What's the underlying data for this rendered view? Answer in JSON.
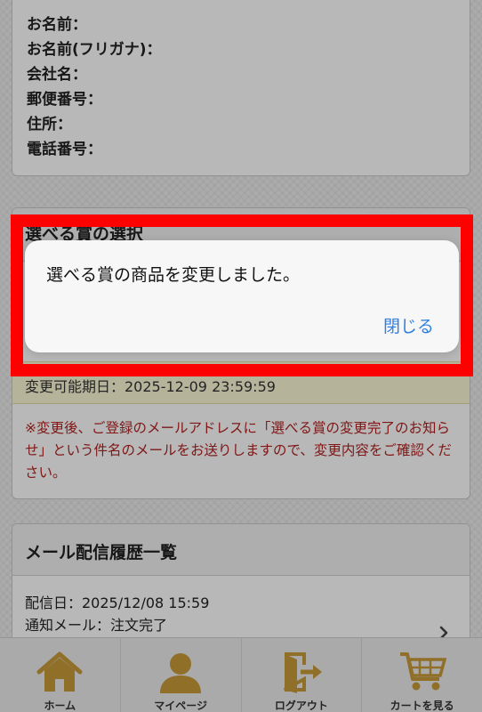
{
  "address": {
    "rows": [
      "お名前：",
      "お名前(フリガナ)：",
      "会社名：",
      "郵便番号：",
      "住所：",
      "電話番号："
    ]
  },
  "prize": {
    "title": "選べる賞の選択",
    "deadline": "変更可能期日：2025-12-09 23:59:59",
    "note": "※変更後、ご登録のメールアドレスに「選べる賞の変更完了のお知らせ」という件名のメールをお送りしますので、変更内容をご確認ください。"
  },
  "mail_history": {
    "title": "メール配信履歴一覧",
    "date": "配信日：2025/12/08 15:59",
    "type": "通知メール：注文完了",
    "icon": "chevron-right-icon"
  },
  "tabbar": {
    "items": [
      {
        "label": "ホーム",
        "icon": "home-icon"
      },
      {
        "label": "マイページ",
        "icon": "user-icon"
      },
      {
        "label": "ログアウト",
        "icon": "logout-icon"
      },
      {
        "label": "カートを見る",
        "icon": "cart-icon"
      }
    ],
    "icon_color": "#c89a3a"
  },
  "alert": {
    "message": "選べる賞の商品を変更しました。",
    "close_label": "閉じる",
    "accent_color": "#2f7fe0"
  },
  "highlight_color": "#ff0000"
}
